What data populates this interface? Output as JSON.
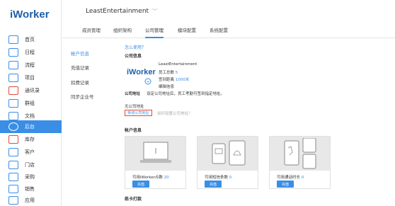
{
  "app": {
    "logo": "iWorker"
  },
  "sidebar": {
    "items": [
      {
        "label": "首页",
        "icon": "monitor-icon"
      },
      {
        "label": "日程",
        "icon": "calendar-icon"
      },
      {
        "label": "流程",
        "icon": "flow-icon"
      },
      {
        "label": "项目",
        "icon": "project-icon"
      },
      {
        "label": "通讯录",
        "icon": "contacts-icon"
      },
      {
        "label": "群组",
        "icon": "group-icon"
      },
      {
        "label": "文档",
        "icon": "document-icon"
      },
      {
        "label": "后台",
        "icon": "gear-icon"
      },
      {
        "label": "库存",
        "icon": "inventory-icon"
      },
      {
        "label": "客户",
        "icon": "customer-icon"
      },
      {
        "label": "门店",
        "icon": "store-icon"
      },
      {
        "label": "采购",
        "icon": "purchase-icon"
      },
      {
        "label": "销售",
        "icon": "sales-icon"
      },
      {
        "label": "应用",
        "icon": "apps-icon"
      }
    ]
  },
  "header": {
    "company": "LeastEntertainment",
    "caret": "﹀"
  },
  "tabs": [
    "成员管理",
    "组织架构",
    "公司管理",
    "模块配置",
    "系统配置"
  ],
  "submenu": [
    "帐户信息",
    "充值记录",
    "扣费记录",
    "同步企业号"
  ],
  "content": {
    "how_to": "怎么使用？",
    "company_info_title": "公司信息",
    "company_logo": "iWorker",
    "company_name": "LeastEntertainment",
    "staff_label": "员工总数",
    "staff_count": "5",
    "checkin_label": "签到距离",
    "checkin_value": "1000米",
    "edit_info": "编辑信息",
    "address_label": "公司地址",
    "address_hint": "设定公司地址后，员工考勤可签到指定地址。",
    "no_address": "无公司地址",
    "add_address": "新增公司地址",
    "how_set_address": "如何设置公司地址？",
    "account_info_title": "帐户信息",
    "cards": [
      {
        "label": "可用iWorker点数",
        "value": "20",
        "button": "充值"
      },
      {
        "label": "可用短信条数",
        "value": "0",
        "button": "充值"
      },
      {
        "label": "可用通话时长",
        "value": "0",
        "button": "充值"
      }
    ],
    "bottom_title": "练卡打款"
  },
  "colors": {
    "accent": "#3a8ee6",
    "brand": "#1f5fa8",
    "highlight": "#e04a3a"
  }
}
